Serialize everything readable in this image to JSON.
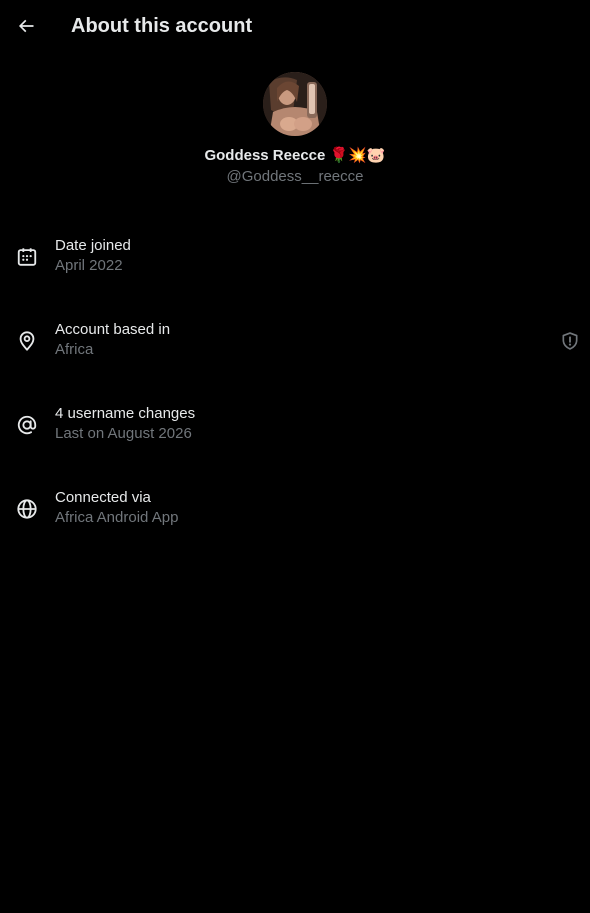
{
  "header": {
    "back_icon": "arrow-left-icon",
    "title": "About this account"
  },
  "profile": {
    "avatar_icon": "profile-photo",
    "display_name": "Goddess Reecce 🌹💥🐷",
    "handle": "@Goddess__reecce"
  },
  "info": [
    {
      "icon": "calendar-icon",
      "label": "Date joined",
      "value": "April 2022"
    },
    {
      "icon": "location-pin-icon",
      "label": "Account based in",
      "value": "Africa",
      "badge_icon": "shield-alert-icon"
    },
    {
      "icon": "at-sign-icon",
      "label": "4 username changes",
      "value": "Last on August 2026"
    },
    {
      "icon": "globe-icon",
      "label": "Connected via",
      "value": "Africa Android App"
    }
  ],
  "colors": {
    "background": "#000000",
    "primary_text": "#e7e9ea",
    "secondary_text": "#71767b"
  }
}
